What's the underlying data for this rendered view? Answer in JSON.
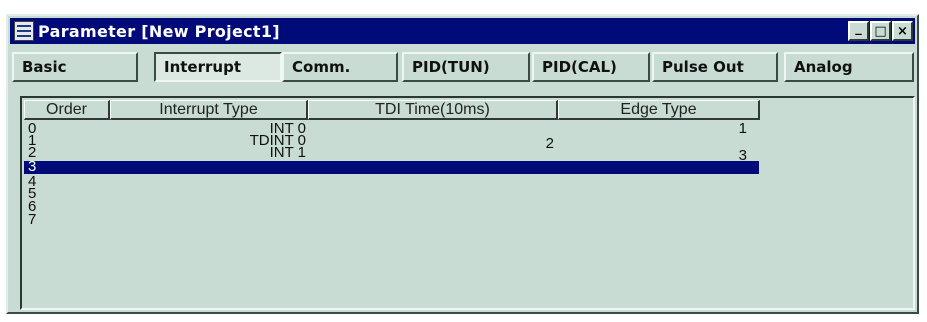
{
  "window": {
    "title": "Parameter [New Project1]",
    "controls": {
      "minimize": "_",
      "maximize": "□",
      "close": "×"
    }
  },
  "tabs": [
    {
      "label": "Basic",
      "active": false
    },
    {
      "label": "Interrupt",
      "active": true
    },
    {
      "label": "Comm.",
      "active": false
    },
    {
      "label": "PID(TUN)",
      "active": false
    },
    {
      "label": "PID(CAL)",
      "active": false
    },
    {
      "label": "Pulse Out",
      "active": false
    },
    {
      "label": "Analog",
      "active": false
    }
  ],
  "table": {
    "columns": [
      "Order",
      "Interrupt Type",
      "TDI Time(10ms)",
      "Edge Type"
    ],
    "rows": [
      {
        "order": "0",
        "interrupt_type": "INT 0",
        "tdi_time": "",
        "edge_type": "1"
      },
      {
        "order": "1",
        "interrupt_type": "TDINT 0",
        "tdi_time": "2",
        "edge_type": ""
      },
      {
        "order": "2",
        "interrupt_type": "INT 1",
        "tdi_time": "",
        "edge_type": "3"
      },
      {
        "order": "3",
        "interrupt_type": "",
        "tdi_time": "",
        "edge_type": ""
      },
      {
        "order": "4",
        "interrupt_type": "",
        "tdi_time": "",
        "edge_type": ""
      },
      {
        "order": "5",
        "interrupt_type": "",
        "tdi_time": "",
        "edge_type": ""
      },
      {
        "order": "6",
        "interrupt_type": "",
        "tdi_time": "",
        "edge_type": ""
      },
      {
        "order": "7",
        "interrupt_type": "",
        "tdi_time": "",
        "edge_type": ""
      }
    ],
    "selected_row": 3
  },
  "colors": {
    "titlebar": "#000a78",
    "face": "#c8dcd4",
    "selection": "#000a78"
  }
}
